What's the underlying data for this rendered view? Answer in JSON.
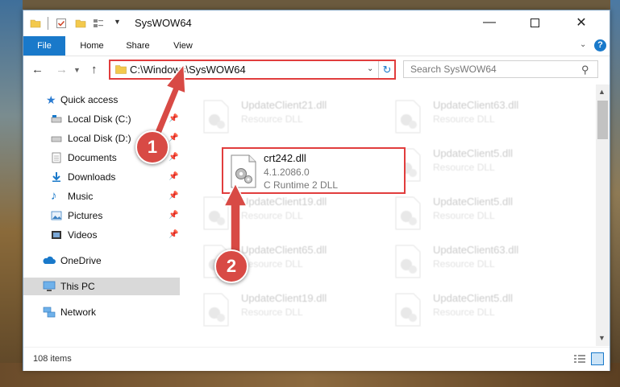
{
  "window": {
    "title": "SysWOW64"
  },
  "ribbon": {
    "tabs": [
      "File",
      "Home",
      "Share",
      "View"
    ]
  },
  "address": {
    "path": "C:\\Windows\\SysWOW64"
  },
  "search": {
    "placeholder": "Search SysWOW64"
  },
  "sidebar": {
    "items": [
      {
        "label": "Quick access",
        "icon": "star-icon"
      },
      {
        "label": "Local Disk (C:)",
        "icon": "drive-icon",
        "pinned": true
      },
      {
        "label": "Local Disk (D:)",
        "icon": "drive-icon",
        "pinned": true
      },
      {
        "label": "Documents",
        "icon": "documents-icon",
        "pinned": true
      },
      {
        "label": "Downloads",
        "icon": "downloads-icon",
        "pinned": true
      },
      {
        "label": "Music",
        "icon": "music-icon",
        "pinned": true
      },
      {
        "label": "Pictures",
        "icon": "pictures-icon",
        "pinned": true
      },
      {
        "label": "Videos",
        "icon": "videos-icon",
        "pinned": true
      },
      {
        "label": "OneDrive",
        "icon": "cloud-icon"
      },
      {
        "label": "This PC",
        "icon": "computer-icon",
        "selected": true
      },
      {
        "label": "Network",
        "icon": "network-icon"
      }
    ]
  },
  "files": {
    "highlighted": {
      "name": "crt242.dll",
      "version": "4.1.2086.0",
      "type": "C Runtime 2 DLL"
    },
    "left_column": [
      {
        "name": "UpdateClient21.dll",
        "type": "Resource DLL"
      },
      {
        "name": "UpdateClient19.dll",
        "type": "Resource DLL"
      },
      {
        "name": "UpdateClient65.dll",
        "type": "Resource DLL"
      },
      {
        "name": "UpdateClient19.dll",
        "type": "Resource DLL"
      }
    ],
    "right_column": [
      {
        "name": "UpdateClient63.dll",
        "type": "Resource DLL"
      },
      {
        "name": "UpdateClient5.dll",
        "type": "Resource DLL"
      },
      {
        "name": "UpdateClient5.dll",
        "type": "Resource DLL"
      },
      {
        "name": "UpdateClient63.dll",
        "type": "Resource DLL"
      },
      {
        "name": "UpdateClient5.dll",
        "type": "Resource DLL"
      }
    ]
  },
  "status": {
    "count": "108 items"
  },
  "callouts": {
    "one": "1",
    "two": "2"
  },
  "colors": {
    "accent": "#1979ca",
    "highlight": "#e13d3d",
    "callout": "#d84a45"
  }
}
